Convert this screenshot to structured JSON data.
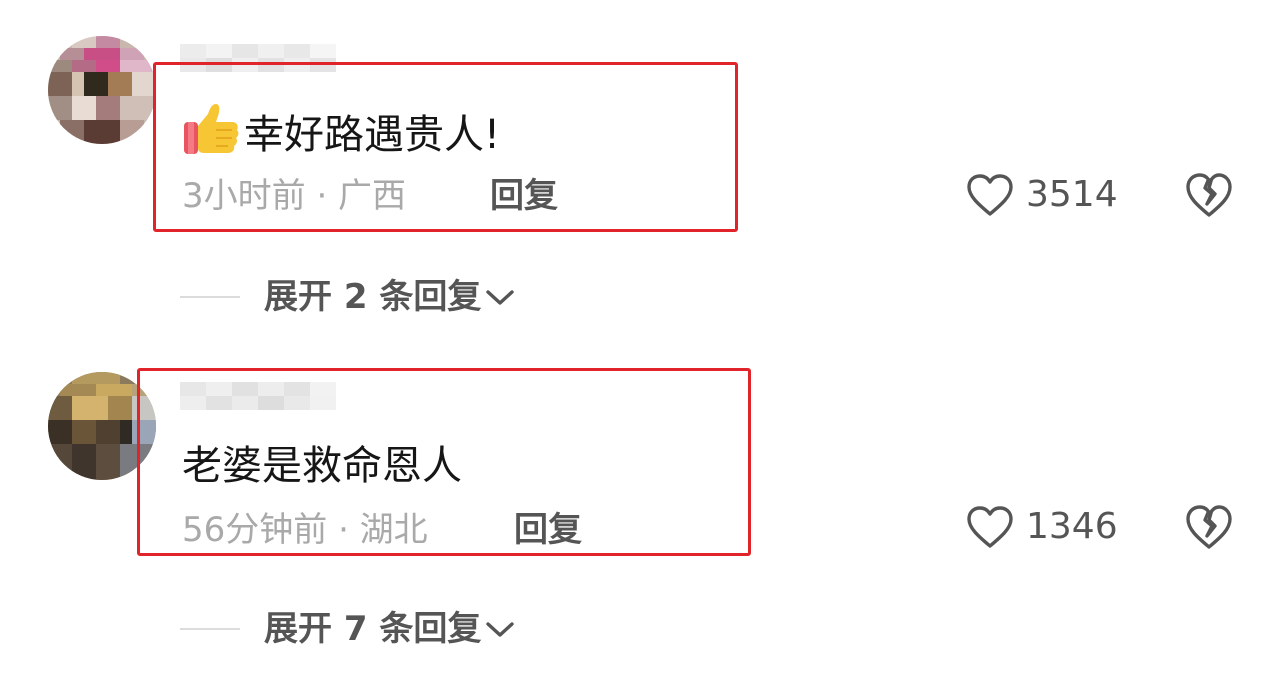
{
  "comments": [
    {
      "text": "幸好路遇贵人!",
      "has_thumb_emoji": true,
      "meta": "3小时前 · 广西",
      "reply_label": "回复",
      "like_count": "3514",
      "expand_label": "展开 2 条回复"
    },
    {
      "text": "老婆是救命恩人",
      "has_thumb_emoji": false,
      "meta": "56分钟前 · 湖北",
      "reply_label": "回复",
      "like_count": "1346",
      "expand_label": "展开 7 条回复"
    }
  ],
  "icons": {
    "like": "heart-outline-icon",
    "dislike": "broken-heart-icon",
    "expand": "chevron-down-icon",
    "thumb": "thumbs-up-emoji"
  },
  "colors": {
    "highlight": "#e0242a",
    "text": "#161616",
    "meta": "#a9a9a9",
    "secondary": "#555555"
  }
}
